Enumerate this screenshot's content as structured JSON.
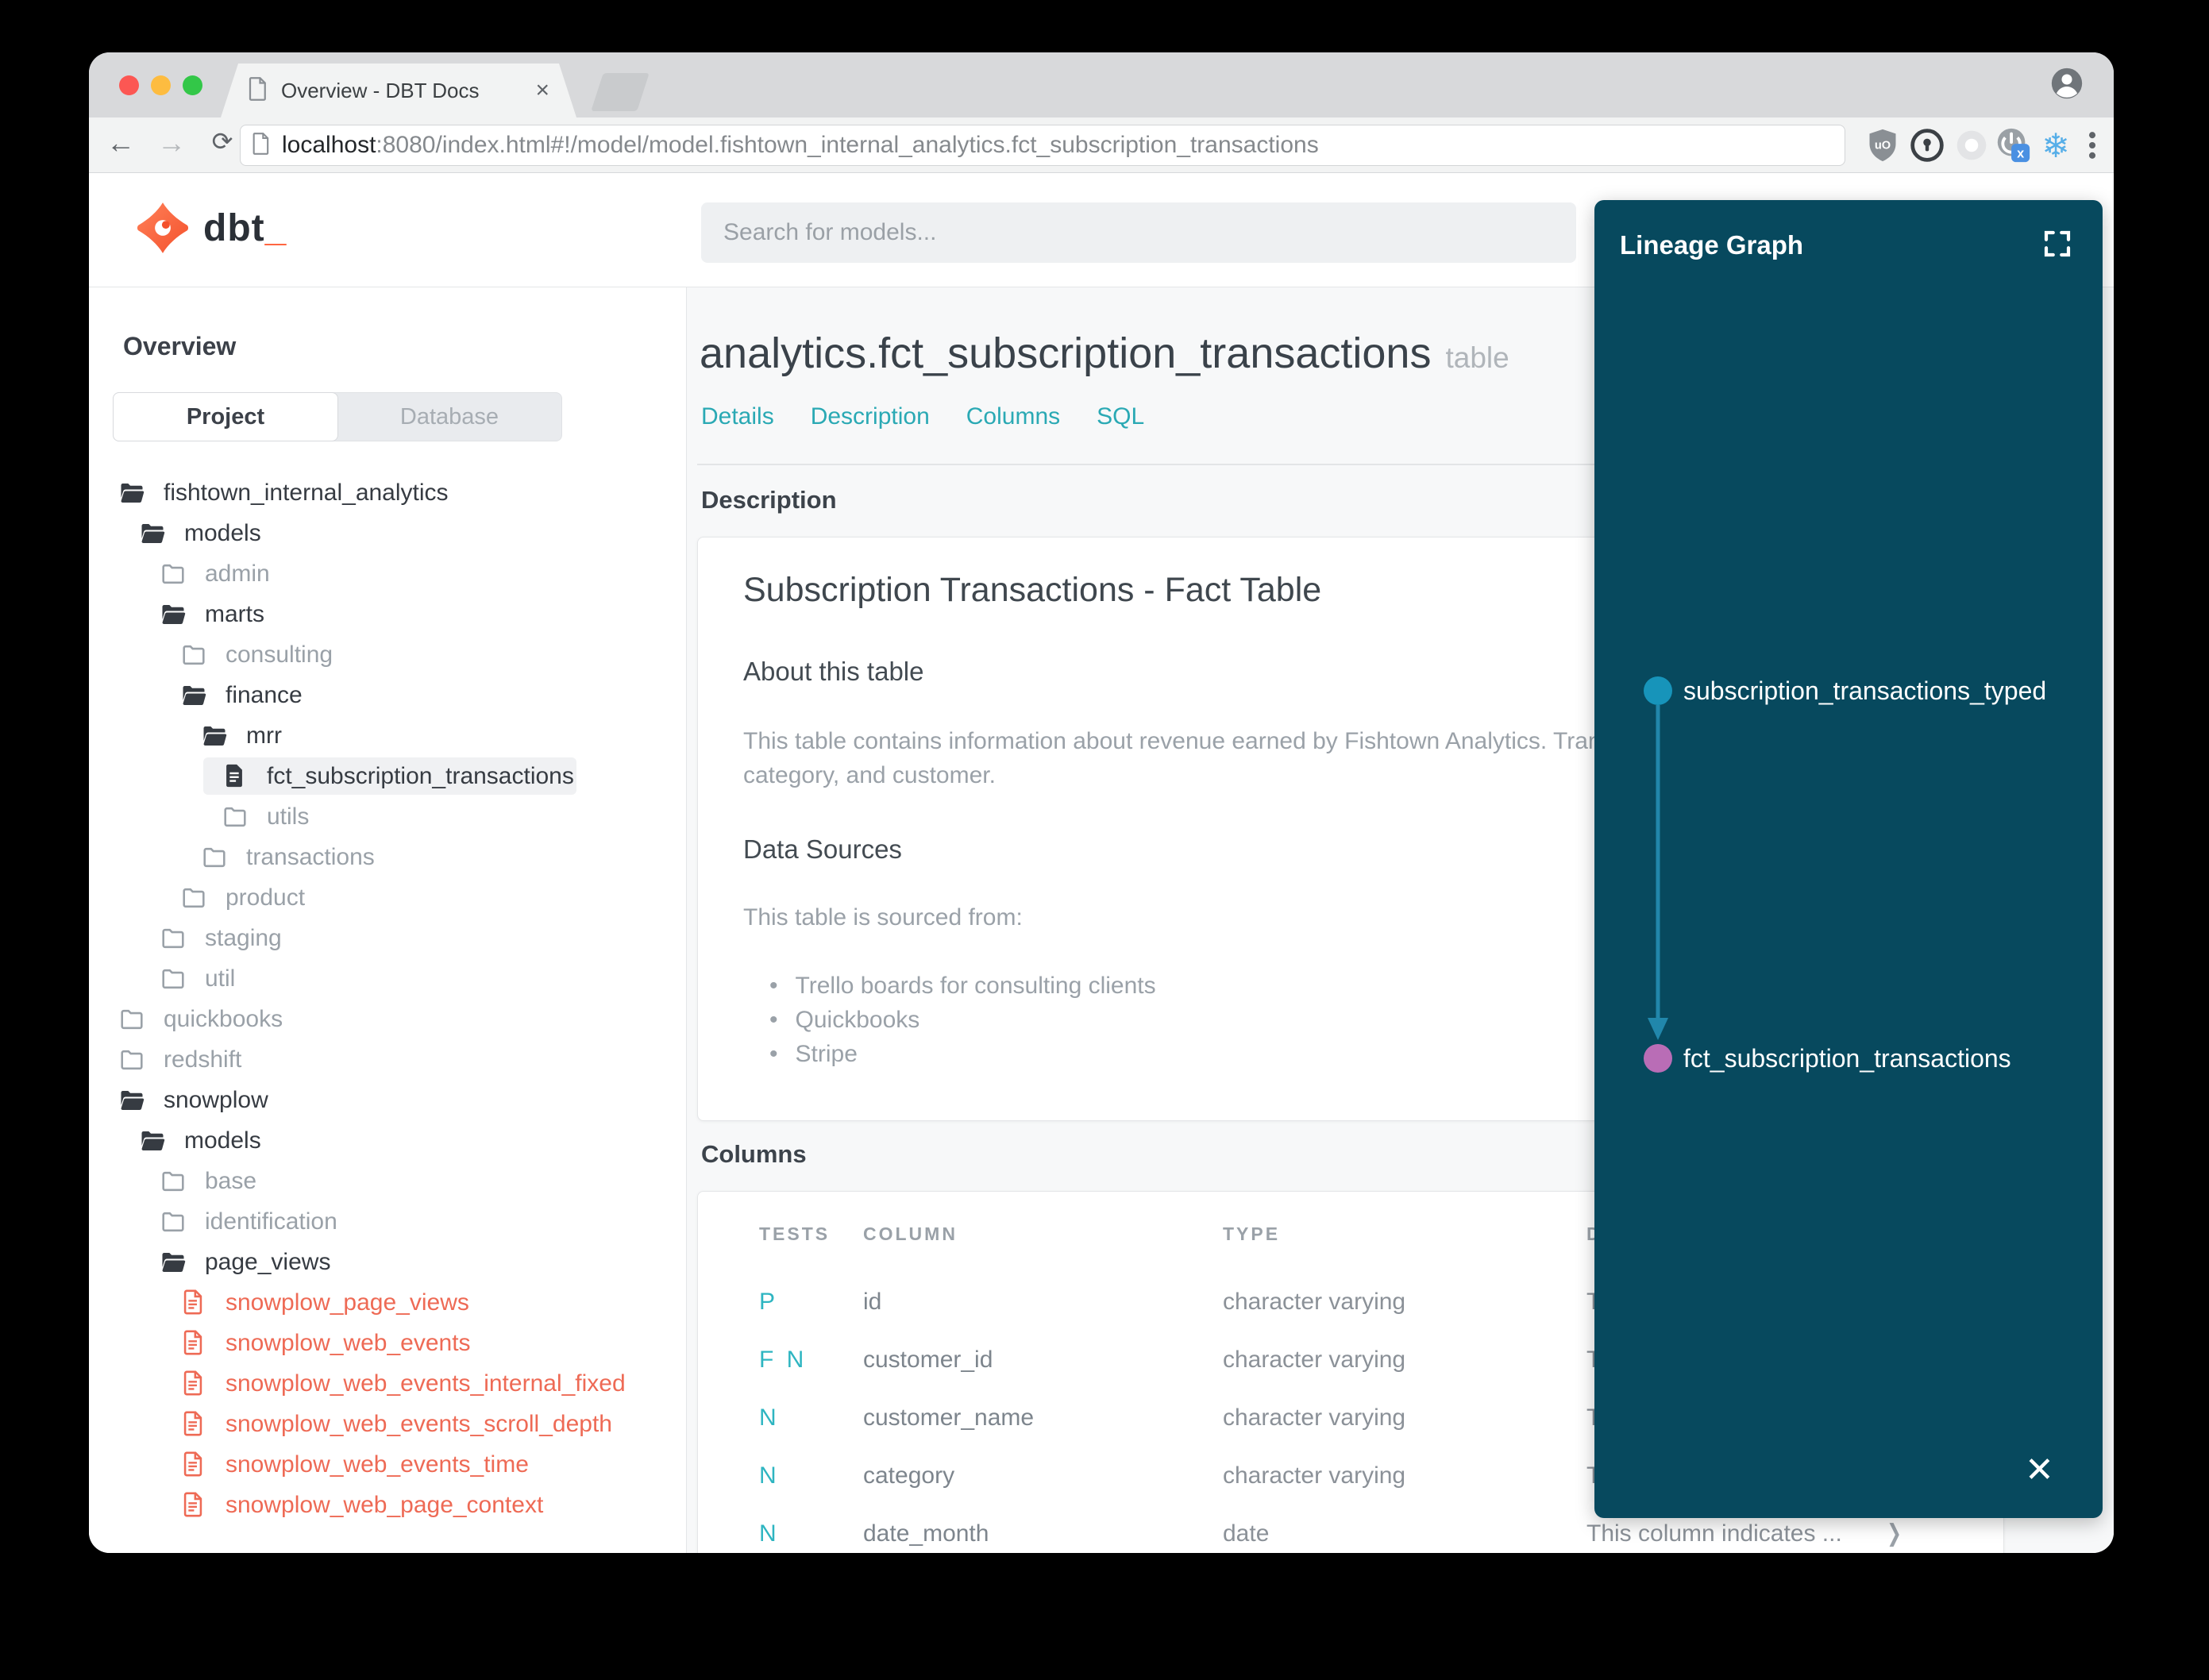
{
  "browser": {
    "tab": {
      "title": "Overview - DBT Docs",
      "close_glyph": "×"
    },
    "nav": {
      "back": "←",
      "forward": "→",
      "reload": "⟳"
    },
    "url": {
      "host": "localhost",
      "rest": ":8080/index.html#!/model/model.fishtown_internal_analytics.fct_subscription_transactions"
    },
    "extensions": {
      "ublock_badge": "uO",
      "power_badge": "x",
      "snowflake_glyph": "❄"
    }
  },
  "header": {
    "logo_text_main": "dbt",
    "logo_text_underscore": "_",
    "search_placeholder": "Search for models..."
  },
  "sidebar": {
    "section_title": "Overview",
    "source_tabs": {
      "project": "Project",
      "database": "Database"
    },
    "tree": [
      {
        "label": "fishtown_internal_analytics",
        "level": 1,
        "icon": "folder-open"
      },
      {
        "label": "models",
        "level": 2,
        "icon": "folder-open"
      },
      {
        "label": "admin",
        "level": 3,
        "icon": "folder"
      },
      {
        "label": "marts",
        "level": 3,
        "icon": "folder-open"
      },
      {
        "label": "consulting",
        "level": 4,
        "icon": "folder"
      },
      {
        "label": "finance",
        "level": 4,
        "icon": "folder-open"
      },
      {
        "label": "mrr",
        "level": 5,
        "icon": "folder-open"
      },
      {
        "label": "fct_subscription_transactions",
        "level": 6,
        "icon": "file",
        "selected": true
      },
      {
        "label": "utils",
        "level": 6,
        "icon": "folder"
      },
      {
        "label": "transactions",
        "level": 5,
        "icon": "folder"
      },
      {
        "label": "product",
        "level": 4,
        "icon": "folder"
      },
      {
        "label": "staging",
        "level": 3,
        "icon": "folder"
      },
      {
        "label": "util",
        "level": 3,
        "icon": "folder"
      },
      {
        "label": "quickbooks",
        "level": 1,
        "icon": "folder"
      },
      {
        "label": "redshift",
        "level": 1,
        "icon": "folder"
      },
      {
        "label": "snowplow",
        "level": 1,
        "icon": "folder-open"
      },
      {
        "label": "models",
        "level": 2,
        "icon": "folder-open"
      },
      {
        "label": "base",
        "level": 3,
        "icon": "folder"
      },
      {
        "label": "identification",
        "level": 3,
        "icon": "folder"
      },
      {
        "label": "page_views",
        "level": 3,
        "icon": "folder-open"
      },
      {
        "label": "snowplow_page_views",
        "level": 4,
        "icon": "file-red"
      },
      {
        "label": "snowplow_web_events",
        "level": 4,
        "icon": "file-red"
      },
      {
        "label": "snowplow_web_events_internal_fixed",
        "level": 4,
        "icon": "file-red"
      },
      {
        "label": "snowplow_web_events_scroll_depth",
        "level": 4,
        "icon": "file-red"
      },
      {
        "label": "snowplow_web_events_time",
        "level": 4,
        "icon": "file-red"
      },
      {
        "label": "snowplow_web_page_context",
        "level": 4,
        "icon": "file-red"
      }
    ]
  },
  "main": {
    "title": "analytics.fct_subscription_transactions",
    "title_badge": "table",
    "tabs": [
      "Details",
      "Description",
      "Columns",
      "SQL"
    ],
    "description_section": {
      "label": "Description",
      "doc_title": "Subscription Transactions - Fact Table",
      "about_heading": "About this table",
      "about_line1": "This table contains information about revenue earned by Fishtown Analytics. Trans",
      "about_line2": "category, and customer.",
      "sources_heading": "Data Sources",
      "sources_intro": "This table is sourced from:",
      "sources": [
        "Trello boards for consulting clients",
        "Quickbooks",
        "Stripe"
      ]
    },
    "columns_section": {
      "label": "Columns",
      "table_headers": [
        "TESTS",
        "COLUMN",
        "TYPE",
        "DESCRIPTION"
      ],
      "row_chevron": "❯",
      "rows": [
        {
          "tests": "P",
          "column": "id",
          "type": "character varying",
          "description": "T"
        },
        {
          "tests": "F N",
          "column": "customer_id",
          "type": "character varying",
          "description": "T"
        },
        {
          "tests": "N",
          "column": "customer_name",
          "type": "character varying",
          "description": "T"
        },
        {
          "tests": "N",
          "column": "category",
          "type": "character varying",
          "description": "T"
        },
        {
          "tests": "N",
          "column": "date_month",
          "type": "date",
          "description": "This column indicates ..."
        }
      ]
    }
  },
  "lineage": {
    "title": "Lineage Graph",
    "close_glyph": "✕",
    "panel_color": "#07495e",
    "edge_color": "#2187ab",
    "nodes": [
      {
        "label": "subscription_transactions_typed",
        "color": "#1794ba"
      },
      {
        "label": "fct_subscription_transactions",
        "color": "#b96db6"
      }
    ]
  },
  "colors": {
    "accent_teal": "#2aa9b4",
    "file_red": "#ee6a55",
    "test_teal": "#2eb5c1",
    "logo_orange": "#ff5c35"
  }
}
